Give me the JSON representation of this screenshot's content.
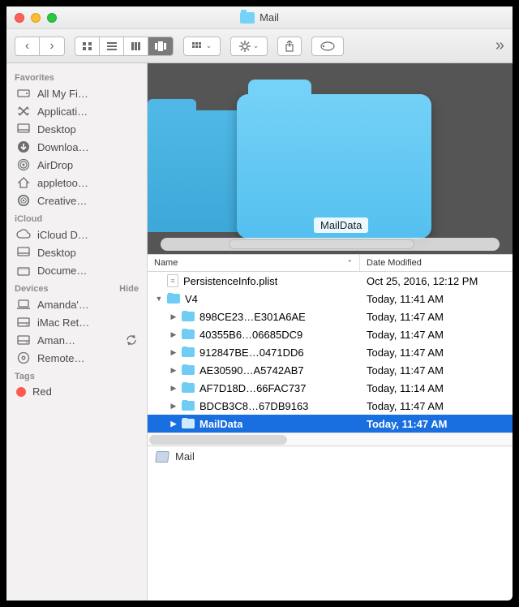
{
  "title": "Mail",
  "sidebar": {
    "sections": [
      {
        "header": "Favorites",
        "hide": "",
        "items": [
          {
            "icon": "disk",
            "label": "All My Fi…"
          },
          {
            "icon": "apps",
            "label": "Applicati…"
          },
          {
            "icon": "desktop",
            "label": "Desktop"
          },
          {
            "icon": "download",
            "label": "Downloa…"
          },
          {
            "icon": "airdrop",
            "label": "AirDrop"
          },
          {
            "icon": "home",
            "label": "appletoo…"
          },
          {
            "icon": "cc",
            "label": "Creative…"
          }
        ]
      },
      {
        "header": "iCloud",
        "hide": "",
        "items": [
          {
            "icon": "cloud",
            "label": "iCloud D…"
          },
          {
            "icon": "desktop",
            "label": "Desktop"
          },
          {
            "icon": "folder",
            "label": "Docume…"
          }
        ]
      },
      {
        "header": "Devices",
        "hide": "Hide",
        "items": [
          {
            "icon": "laptop",
            "label": "Amanda'…"
          },
          {
            "icon": "hdd",
            "label": "iMac Ret…"
          },
          {
            "icon": "hdd",
            "label": "Aman…",
            "sync": true
          },
          {
            "icon": "disc",
            "label": "Remote…"
          }
        ]
      },
      {
        "header": "Tags",
        "hide": "",
        "items": [
          {
            "icon": "tag-red",
            "label": "Red"
          }
        ]
      }
    ]
  },
  "coverflow": {
    "selected_label": "MailData"
  },
  "list": {
    "columns": {
      "name": "Name",
      "date": "Date Modified"
    },
    "rows": [
      {
        "indent": 0,
        "disclosure": "",
        "type": "file",
        "name": "PersistenceInfo.plist",
        "date": "Oct 25, 2016, 12:12 PM",
        "sel": false
      },
      {
        "indent": 0,
        "disclosure": "down",
        "type": "folder",
        "name": "V4",
        "date": "Today, 11:41 AM",
        "sel": false
      },
      {
        "indent": 1,
        "disclosure": "right",
        "type": "folder",
        "name": "898CE23…E301A6AE",
        "date": "Today, 11:47 AM",
        "sel": false
      },
      {
        "indent": 1,
        "disclosure": "right",
        "type": "folder",
        "name": "40355B6…06685DC9",
        "date": "Today, 11:47 AM",
        "sel": false
      },
      {
        "indent": 1,
        "disclosure": "right",
        "type": "folder",
        "name": "912847BE…0471DD6",
        "date": "Today, 11:47 AM",
        "sel": false
      },
      {
        "indent": 1,
        "disclosure": "right",
        "type": "folder",
        "name": "AE30590…A5742AB7",
        "date": "Today, 11:47 AM",
        "sel": false
      },
      {
        "indent": 1,
        "disclosure": "right",
        "type": "folder",
        "name": "AF7D18D…66FAC737",
        "date": "Today, 11:14 AM",
        "sel": false
      },
      {
        "indent": 1,
        "disclosure": "right",
        "type": "folder",
        "name": "BDCB3C8…67DB9163",
        "date": "Today, 11:47 AM",
        "sel": false
      },
      {
        "indent": 1,
        "disclosure": "right",
        "type": "folder",
        "name": "MailData",
        "date": "Today, 11:47 AM",
        "sel": true
      }
    ]
  },
  "pathbar": {
    "label": "Mail"
  }
}
